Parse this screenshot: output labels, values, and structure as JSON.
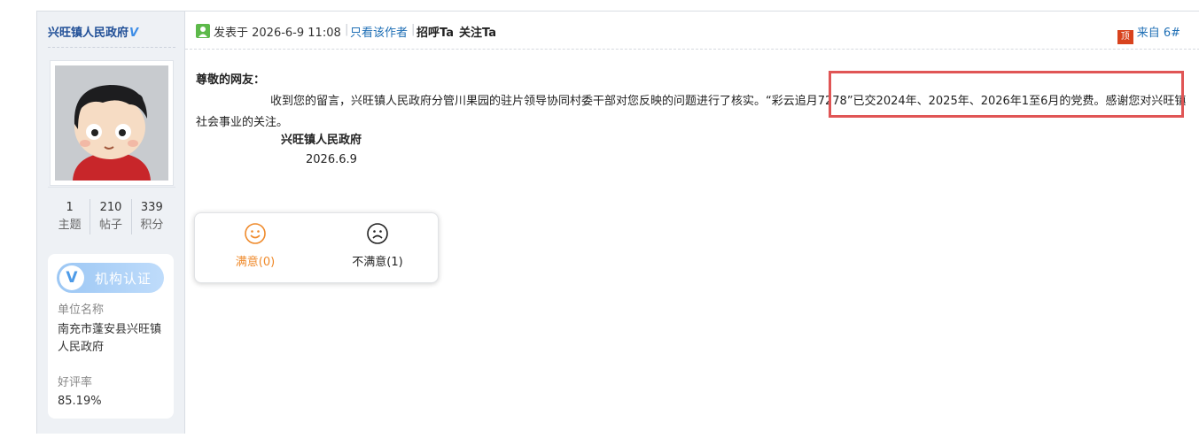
{
  "author": {
    "name": "兴旺镇人民政府",
    "verified_mark": "V"
  },
  "stats": [
    {
      "num": "1",
      "label": "主题"
    },
    {
      "num": "210",
      "label": "帖子"
    },
    {
      "num": "339",
      "label": "积分"
    }
  ],
  "card": {
    "badge": "机构认证",
    "badge_letter": "V",
    "org_label": "单位名称",
    "org_value": "南充市蓬安县兴旺镇人民政府",
    "rate_label": "好评率",
    "rate_value": "85.19%"
  },
  "post_head": {
    "posted": "发表于 2026-6-9 11:08",
    "only_author": "只看该作者",
    "greet": "招呼Ta",
    "follow": "关注Ta",
    "floor_icon": "顶",
    "floor": "来自 6#"
  },
  "body": {
    "salutation": "尊敬的网友：",
    "paragraph": "收到您的留言，兴旺镇人民政府分管川果园的驻片领导协同村委干部对您反映的问题进行了核实。“彩云追月7278”已交2024年、2025年、2026年1至6月的党费。感谢您对兴旺镇社会事业的关注。",
    "signature": "兴旺镇人民政府",
    "date": "2026.6.9"
  },
  "vote": {
    "satisfied": "满意(0)",
    "unsatisfied": "不满意(1)",
    "satisfied_color": "#ef8a2b",
    "unsatisfied_color": "#222222"
  },
  "icons": {
    "online": "online-status-icon",
    "floor": "top-floor-icon",
    "smile": "smile-face-icon",
    "frown": "frown-face-icon",
    "avatar": "cartoon-avatar"
  },
  "colors": {
    "highlight_box": "#e05555",
    "link": "#1f6fb5",
    "author": "#1f4e96"
  }
}
